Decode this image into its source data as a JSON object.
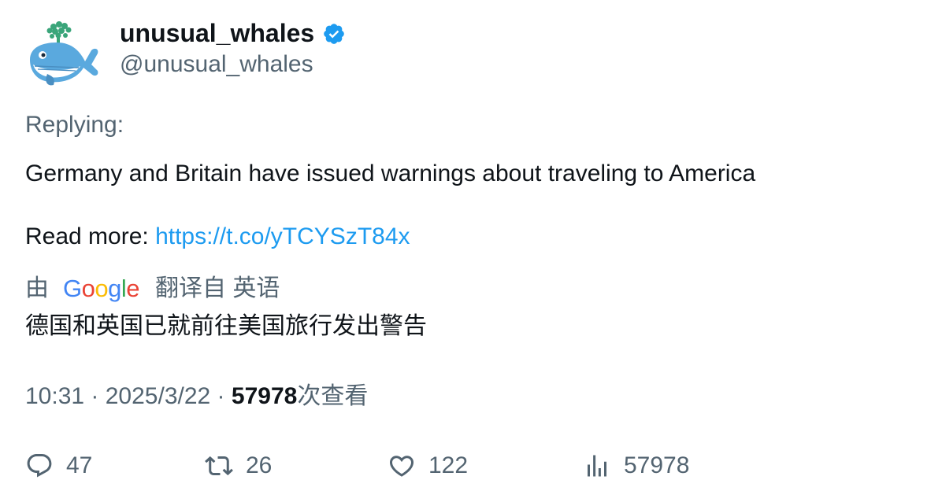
{
  "author": {
    "display_name": "unusual_whales",
    "handle": "@unusual_whales",
    "verified": true,
    "avatar_icon": "whale-icon"
  },
  "tweet": {
    "replying_label": "Replying:",
    "text": "Germany and Britain have issued warnings about traveling to America",
    "read_more_label": "Read more: ",
    "link": "https://t.co/yTCYSzT84x"
  },
  "translation": {
    "prefix": "由",
    "provider_logo": "Google",
    "suffix": "翻译自 英语",
    "text": "德国和英国已就前往美国旅行发出警告"
  },
  "meta": {
    "time": "10:31",
    "date": "2025/3/22",
    "separator": " · ",
    "views": "57978",
    "views_label": "次查看"
  },
  "actions": {
    "replies": "47",
    "retweets": "26",
    "likes": "122",
    "views": "57978"
  },
  "colors": {
    "link": "#1d9bf0",
    "secondary_text": "#536471",
    "primary_text": "#0f1419",
    "verified_badge": "#1d9bf0"
  }
}
